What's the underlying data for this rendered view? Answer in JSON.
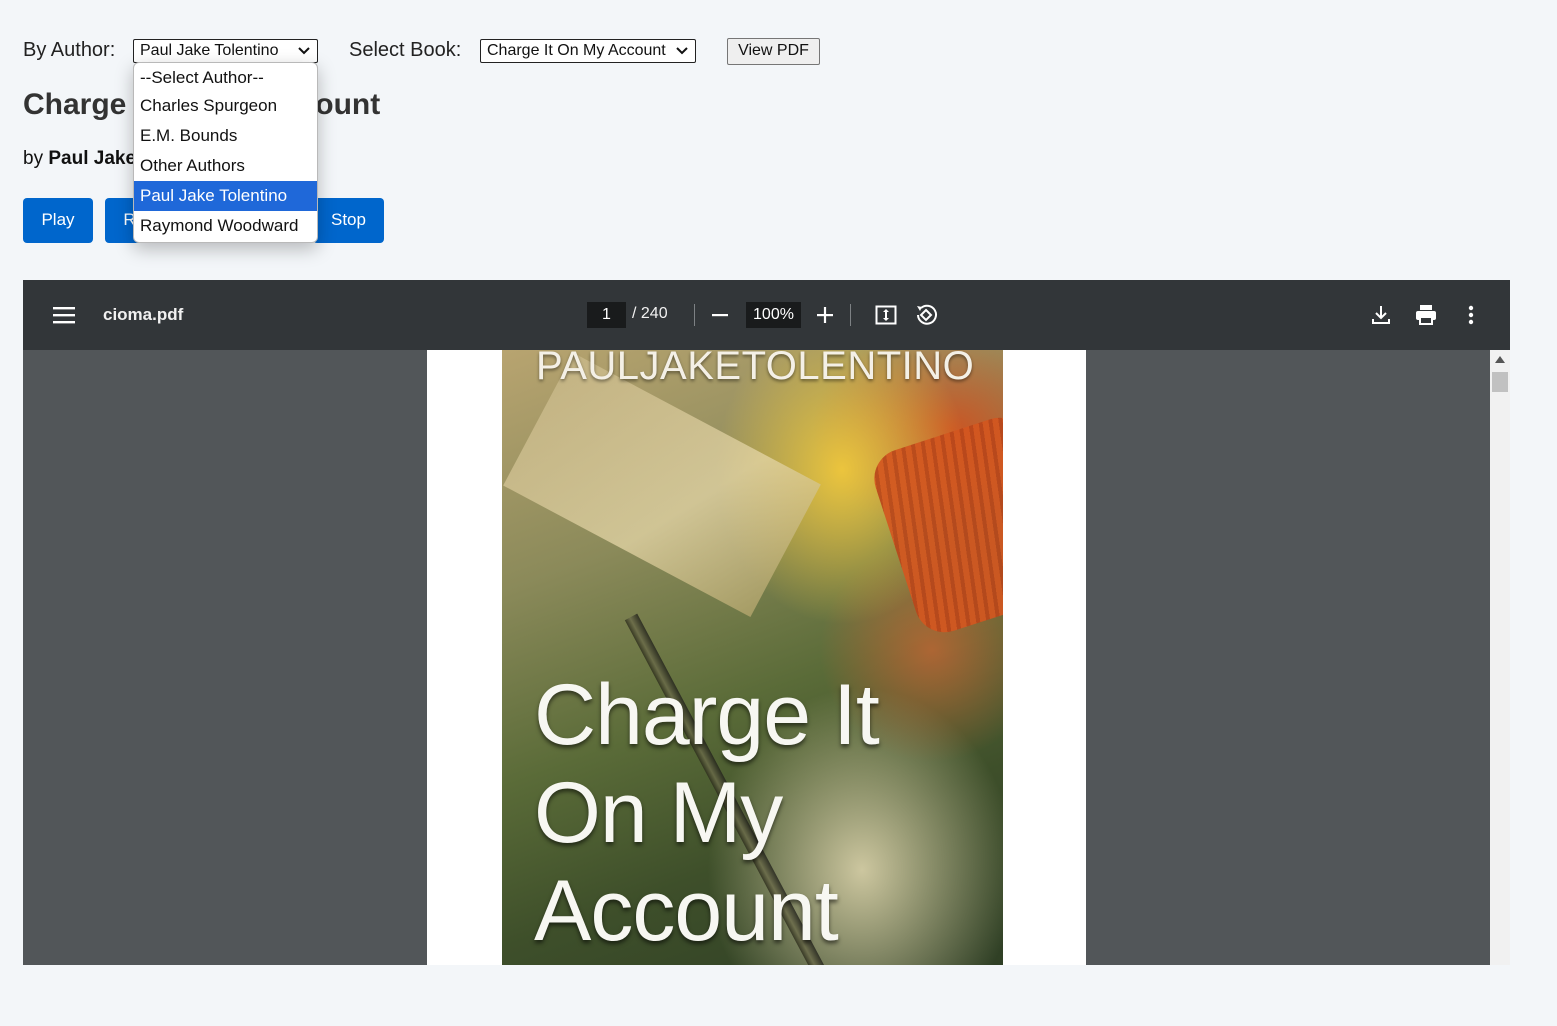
{
  "controls": {
    "author_label": "By Author:",
    "author_selected": "Paul Jake Tolentino",
    "book_label": "Select Book:",
    "book_selected": "Charge It On My Account",
    "view_pdf_label": "View PDF"
  },
  "author_dropdown": {
    "options": [
      "--Select Author--",
      "Charles Spurgeon",
      "E.M. Bounds",
      "Other Authors",
      "Paul Jake Tolentino",
      "Raymond Woodward"
    ],
    "selected_index": 4
  },
  "book": {
    "title": "Charge It On My Account",
    "by_prefix": "by",
    "author": "Paul Jake Tolentino"
  },
  "audio_buttons": {
    "play": "Play",
    "resume": "Resume",
    "stop": "Stop"
  },
  "pdf_viewer": {
    "filename": "cioma.pdf",
    "current_page": "1",
    "total_pages": "/ 240",
    "zoom": "100%",
    "icons": [
      "menu-icon",
      "zoom-out-icon",
      "zoom-in-icon",
      "fit-page-icon",
      "rotate-icon",
      "download-icon",
      "print-icon",
      "more-options-icon"
    ]
  },
  "cover": {
    "author_text": "PAULJAKETOLENTINO",
    "title_text": "Charge It\nOn My\nAccount"
  },
  "colors": {
    "page_bg": "#f3f6f9",
    "button_blue": "#0066cc",
    "option_highlight": "#1f68d9",
    "viewer_bg": "#525659",
    "toolbar_bg": "#323639"
  }
}
